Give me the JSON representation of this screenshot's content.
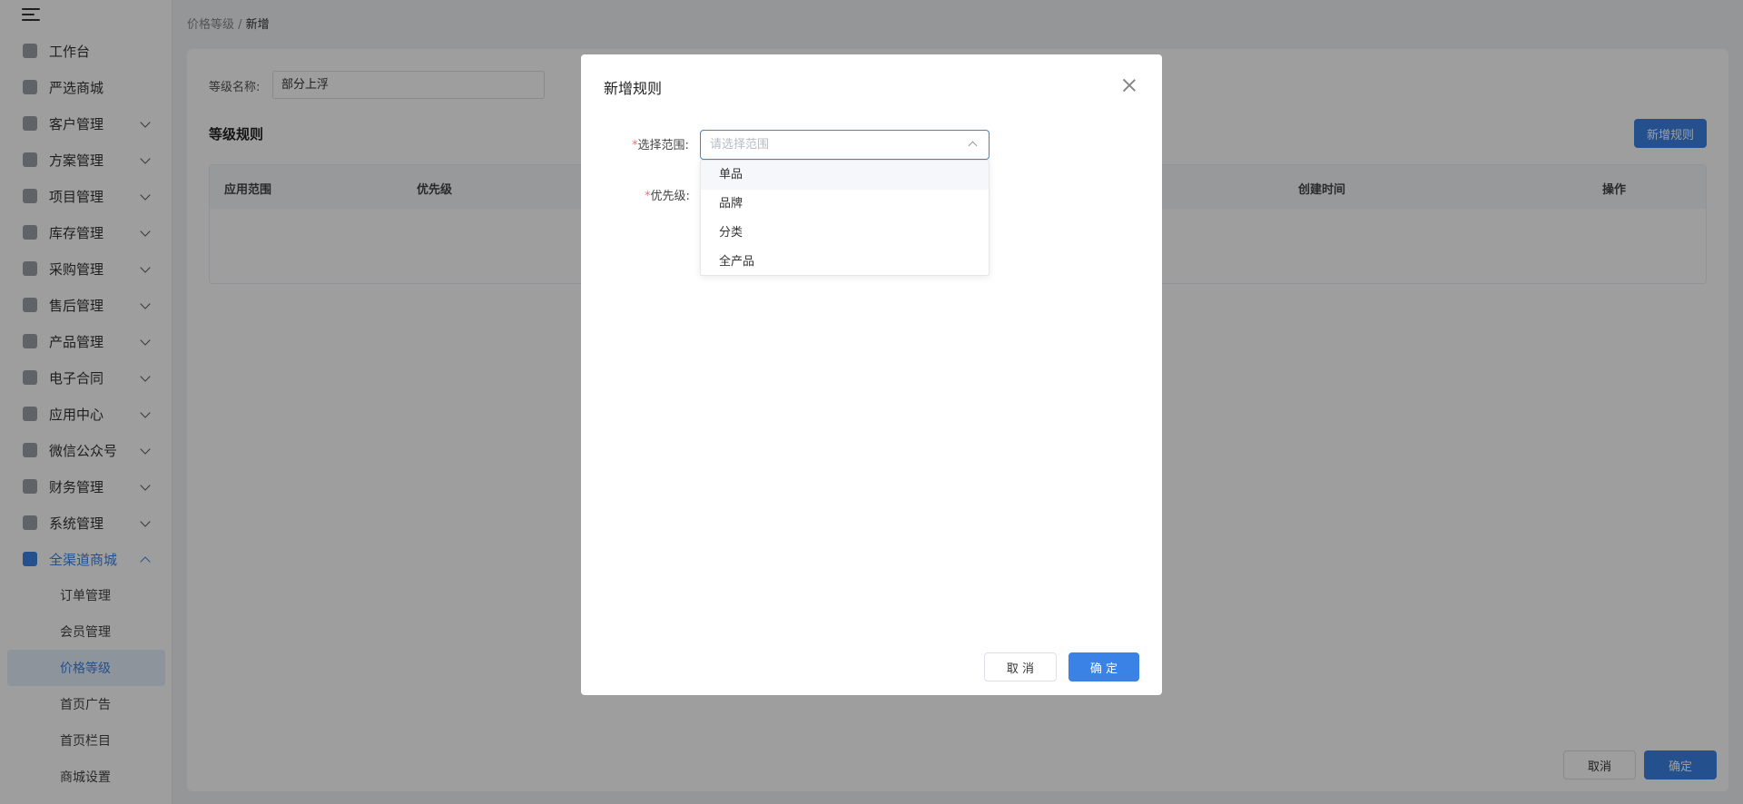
{
  "breadcrumb": {
    "parent": "价格等级",
    "separator": " / ",
    "current": "新增"
  },
  "sidebar": {
    "items": [
      {
        "label": "工作台",
        "icon": "home-icon"
      },
      {
        "label": "严选商城",
        "icon": "chart-icon"
      },
      {
        "label": "客户管理",
        "icon": "user-icon"
      },
      {
        "label": "方案管理",
        "icon": "document-icon"
      },
      {
        "label": "项目管理",
        "icon": "folder-icon"
      },
      {
        "label": "库存管理",
        "icon": "boxes-icon"
      },
      {
        "label": "采购管理",
        "icon": "cart-icon"
      },
      {
        "label": "售后管理",
        "icon": "headset-icon"
      },
      {
        "label": "产品管理",
        "icon": "cube-icon"
      },
      {
        "label": "电子合同",
        "icon": "contract-icon"
      },
      {
        "label": "应用中心",
        "icon": "apps-icon"
      },
      {
        "label": "微信公众号",
        "icon": "wechat-icon"
      },
      {
        "label": "财务管理",
        "icon": "money-bag-icon"
      },
      {
        "label": "系统管理",
        "icon": "settings-icon"
      },
      {
        "label": "全渠道商城",
        "icon": "mail-icon"
      }
    ],
    "submenu": [
      "订单管理",
      "会员管理",
      "价格等级",
      "首页广告",
      "首页栏目",
      "商城设置"
    ],
    "active_sub": "价格等级"
  },
  "form": {
    "level_name_label": "等级名称:",
    "level_name_value": "部分上浮"
  },
  "section": {
    "title": "等级规则",
    "add_rule_button": "新增规则"
  },
  "table": {
    "headers": [
      "应用范围",
      "优先级",
      "创建时间",
      "操作"
    ]
  },
  "footer": {
    "cancel": "取消",
    "confirm": "确定"
  },
  "modal": {
    "title": "新增规则",
    "scope_label": "选择范围:",
    "scope_placeholder": "请选择范围",
    "priority_label": "优先级:",
    "required_mark": "*",
    "options": [
      "单品",
      "品牌",
      "分类",
      "全产品"
    ],
    "cancel": "取 消",
    "confirm": "确 定"
  },
  "colors": {
    "primary": "#3b82e6",
    "required": "#f56c6c",
    "overlay": "rgba(0,0,0,0.38)"
  }
}
